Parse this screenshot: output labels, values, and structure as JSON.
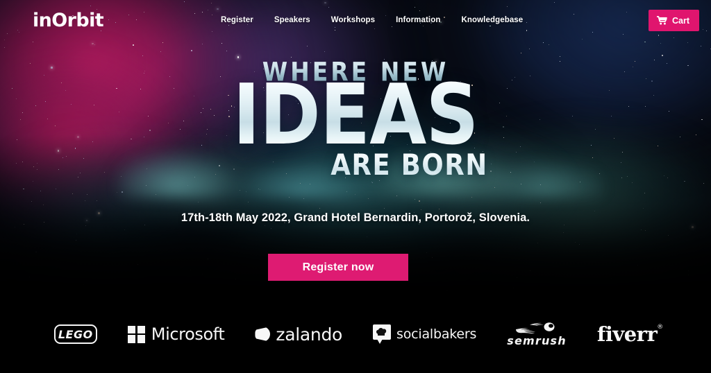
{
  "brand": {
    "logo_text": "inOrbit"
  },
  "nav": {
    "items": [
      {
        "label": "Register"
      },
      {
        "label": "Speakers"
      },
      {
        "label": "Workshops"
      },
      {
        "label": "Information"
      },
      {
        "label": "Knowledgebase"
      }
    ],
    "cart": {
      "label": "Cart",
      "icon": "shopping-cart-icon",
      "color": "#e0156e"
    }
  },
  "hero": {
    "line1": "WHERE NEW",
    "line2": "IDEAS",
    "line3": "ARE BORN",
    "event_details": "17th-18th May 2022, Grand Hotel Bernardin, Portorož, Slovenia.",
    "cta": {
      "label": "Register now",
      "color": "#de1b72"
    },
    "background": "space-nebula-starfield"
  },
  "partners": {
    "items": [
      {
        "name": "LEGO",
        "mark": "lego-wordmark-outline"
      },
      {
        "name": "Microsoft",
        "mark": "microsoft-four-squares-icon"
      },
      {
        "name": "zalando",
        "mark": "zalando-swoosh-icon"
      },
      {
        "name": "socialbakers",
        "mark": "socialbakers-bubble-icon"
      },
      {
        "name": "semrush",
        "mark": "semrush-comet-icon"
      },
      {
        "name": "fiverr",
        "mark": "fiverr-registered-mark",
        "suffix": "®"
      }
    ]
  },
  "colors": {
    "accent_pink": "#de1b72",
    "cart_pink": "#e0156e",
    "background_black": "#000000",
    "nebula_magenta": "#b21a64",
    "nebula_teal": "#38a0a0",
    "nebula_navy": "#1e386e"
  }
}
